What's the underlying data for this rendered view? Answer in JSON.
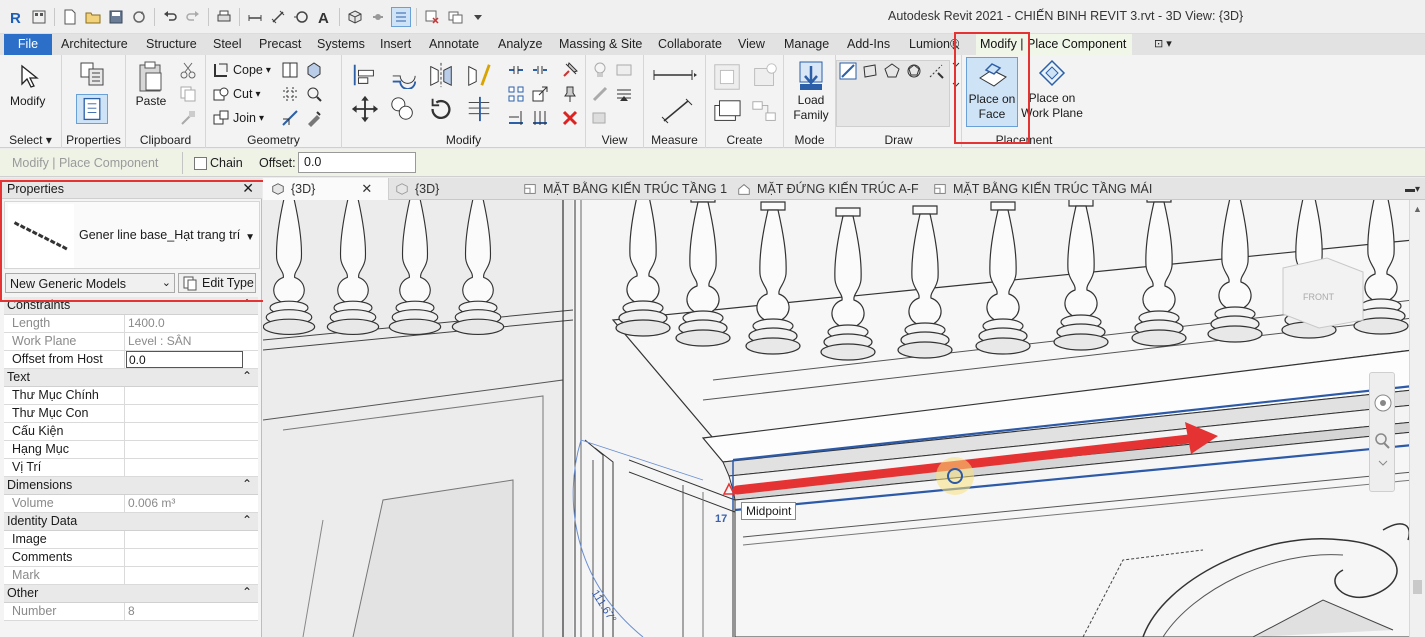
{
  "window": {
    "title": "Autodesk Revit 2021 - CHIẾN BINH REVIT 3.rvt - 3D View: {3D}"
  },
  "qat": {
    "icons": [
      "revit-logo-icon",
      "open-icon",
      "save-icon",
      "sync-icon",
      "undo-icon",
      "redo-icon",
      "print-icon",
      "measure-icon",
      "text-icon",
      "3d-view-icon",
      "thin-lines-icon",
      "close-hidden-icon",
      "switch-windows-icon"
    ]
  },
  "ribbon_tabs": [
    "File",
    "Architecture",
    "Structure",
    "Steel",
    "Precast",
    "Systems",
    "Insert",
    "Annotate",
    "Analyze",
    "Massing & Site",
    "Collaborate",
    "View",
    "Manage",
    "Add-Ins",
    "Lumion®",
    "Modify | Place Component"
  ],
  "panels": {
    "select": {
      "title": "Select ▾",
      "modify_label": "Modify"
    },
    "properties": {
      "title": "Properties"
    },
    "clipboard": {
      "title": "Clipboard",
      "paste_label": "Paste"
    },
    "geometry": {
      "title": "Geometry",
      "cope_label": "Cope",
      "cut_label": "Cut",
      "join_label": "Join"
    },
    "modify": {
      "title": "Modify"
    },
    "view": {
      "title": "View"
    },
    "measure": {
      "title": "Measure"
    },
    "create": {
      "title": "Create"
    },
    "mode": {
      "title": "Mode",
      "load_family_label": "Load Family"
    },
    "draw": {
      "title": "Draw"
    },
    "placement": {
      "title": "Placement",
      "place_on_face": "Place on Face",
      "place_on_work_plane": "Place on Work Plane"
    }
  },
  "options_bar": {
    "context": "Modify | Place Component",
    "chain_label": "Chain",
    "chain_checked": false,
    "offset_label": "Offset:",
    "offset_value": "0.0"
  },
  "properties": {
    "title": "Properties",
    "type_name": "Gener line base_Hạt trang trí",
    "category_select": "New Generic Models",
    "edit_type_label": "Edit Type",
    "groups": [
      {
        "name": "Constraints",
        "rows": [
          {
            "key": "Length",
            "value": "1400.0",
            "readonly": true
          },
          {
            "key": "Work Plane",
            "value": "Level : SÂN",
            "readonly": true
          },
          {
            "key": "Offset from Host",
            "value": "0.0",
            "readonly": false,
            "editing": true
          }
        ]
      },
      {
        "name": "Text",
        "rows": [
          {
            "key": "Thư Mục Chính",
            "value": ""
          },
          {
            "key": "Thư Mục Con",
            "value": ""
          },
          {
            "key": "Cấu Kiện",
            "value": ""
          },
          {
            "key": "Hạng Mục",
            "value": ""
          },
          {
            "key": "Vị Trí",
            "value": ""
          }
        ]
      },
      {
        "name": "Dimensions",
        "rows": [
          {
            "key": "Volume",
            "value": "0.006 m³",
            "readonly": true
          }
        ]
      },
      {
        "name": "Identity Data",
        "rows": [
          {
            "key": "Image",
            "value": ""
          },
          {
            "key": "Comments",
            "value": ""
          },
          {
            "key": "Mark",
            "value": "",
            "readonly": true
          }
        ]
      },
      {
        "name": "Other",
        "rows": [
          {
            "key": "Number",
            "value": "8",
            "readonly": true
          }
        ]
      }
    ]
  },
  "view_tabs": [
    {
      "label": "{3D}",
      "active": true
    },
    {
      "label": "{3D}",
      "active": false
    },
    {
      "label": "MẶT BẰNG KIẾN TRÚC TẦNG 1",
      "active": false
    },
    {
      "label": "MẶT ĐỨNG KIẾN TRÚC A-F",
      "active": false
    },
    {
      "label": "MẶT BẰNG KIẾN TRÚC TẦNG MÁI",
      "active": false
    }
  ],
  "viewport": {
    "snap_tooltip": "Midpoint",
    "dimension_a": "17",
    "dimension_b": "111.67°",
    "viewcube_face": "FRONT"
  },
  "colors": {
    "highlight": "#e53333",
    "file_tab": "#2b6fc8",
    "context_tab": "#d4ecbd",
    "line": "#2d5aa8"
  }
}
